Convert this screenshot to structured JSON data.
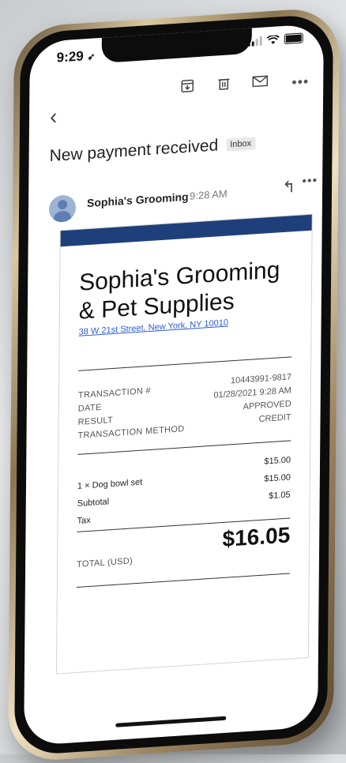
{
  "status_bar": {
    "time": "9:29",
    "location_glyph": "➶"
  },
  "toolbar": {
    "archive_icon": "archive-icon",
    "delete_icon": "trash-icon",
    "mail_icon": "mail-icon",
    "more_glyph": "•••"
  },
  "nav": {
    "back_glyph": "‹"
  },
  "email": {
    "subject": "New payment received",
    "folder_chip": "Inbox",
    "sender": "Sophia's Grooming",
    "time": "9:28 AM",
    "reply_glyph": "↰",
    "more_glyph": "•••"
  },
  "receipt": {
    "band_color": "#1f3f7a",
    "business_name": "Sophia's Grooming & Pet Supplies",
    "address": "38 W 21st Street, New York, NY 10010",
    "transaction_labels": [
      "TRANSACTION #",
      "DATE",
      "RESULT",
      "TRANSACTION METHOD"
    ],
    "transaction_values": [
      "10443991-9817",
      "01/28/2021 9:28 AM",
      "APPROVED",
      "CREDIT"
    ],
    "items": [
      {
        "label": "1 × Dog bowl set",
        "amount": "$15.00"
      },
      {
        "label": "Subtotal",
        "amount": "$15.00"
      },
      {
        "label": "Tax",
        "amount": "$1.05"
      }
    ],
    "item_header_amount": "$15.00",
    "total_label": "TOTAL (USD)",
    "total_value": "$16.05"
  }
}
